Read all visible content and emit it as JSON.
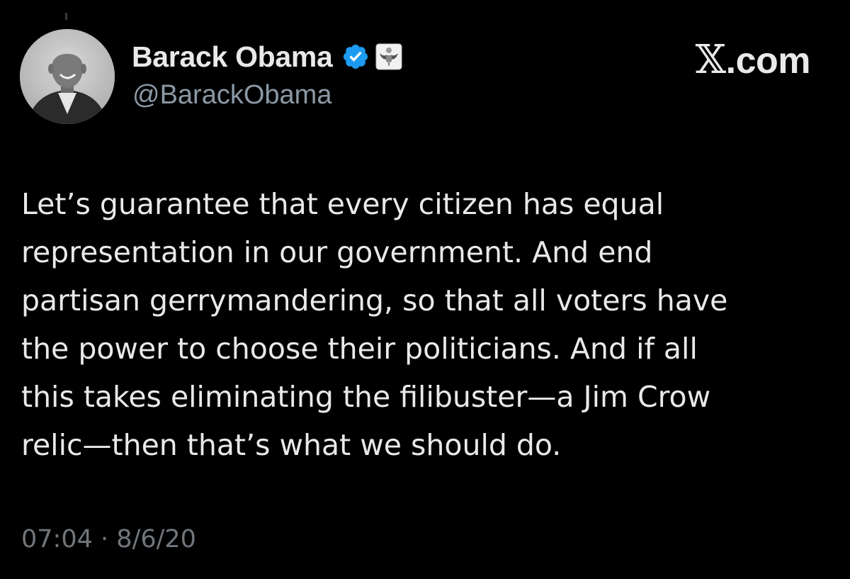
{
  "author": {
    "display_name": "Barack Obama",
    "handle": "@BarackObama"
  },
  "brand": {
    "x_letter": "𝕏",
    "suffix": ".com"
  },
  "tweet": {
    "lines": [
      "Let’s guarantee that every citizen has equal",
      "representation in our government. And end",
      "partisan gerrymandering, so that all voters have",
      "the power to choose their politicians. And if all",
      "this takes eliminating the filibuster—a Jim Crow",
      "relic—then that’s what we should do."
    ],
    "time": "07:04",
    "separator": "·",
    "date": "8/6/20"
  },
  "icons": {
    "verified": "verified-badge-icon",
    "government": "government-seal-icon",
    "avatar": "profile-photo"
  },
  "colors": {
    "background": "#000000",
    "text_primary": "#e7e9ea",
    "text_secondary": "#71767b",
    "verified_blue": "#1d9bf0"
  }
}
